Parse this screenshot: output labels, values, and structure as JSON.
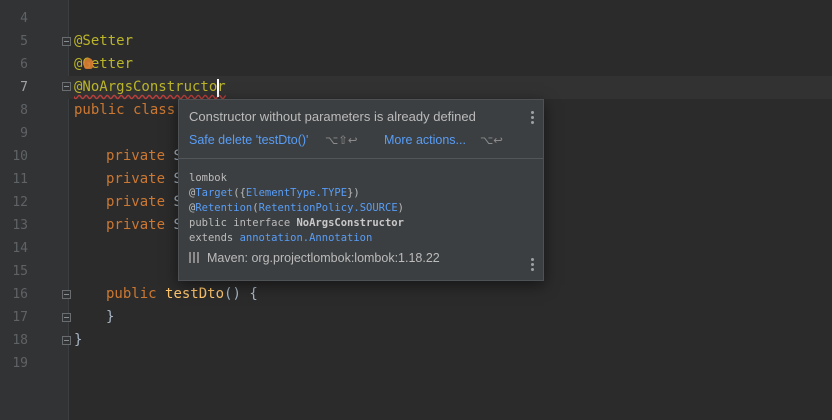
{
  "editor": {
    "line_numbers": [
      "5",
      "6",
      "7",
      "8",
      "9",
      "10",
      "11",
      "12",
      "13",
      "14",
      "15",
      "16",
      "17",
      "18",
      "19"
    ],
    "top_line_number": "4",
    "lines": {
      "l5": "@Setter",
      "l6_a": "@",
      "l6_b": "Getter",
      "l7": "@NoArgsConstructor",
      "l8_kw": "public class",
      "l10_kw": "private",
      "l10_rest": " S",
      "l11_kw": "private",
      "l11_rest": " S",
      "l12_kw": "private",
      "l12_rest": " S",
      "l13_kw": "private",
      "l13_rest": " S",
      "l16_kw": "public",
      "l16_fn": "testDto",
      "l16_rest": "() {",
      "l17": "}",
      "l18": "}"
    }
  },
  "popup": {
    "message": "Constructor without parameters is already defined",
    "action_primary": "Safe delete 'testDto()'",
    "action_primary_shortcut": "⌥⇧↩",
    "action_more": "More actions...",
    "action_more_shortcut": "⌥↩",
    "doc": {
      "package": "lombok",
      "target_at": "@",
      "target_name": "Target",
      "target_open": "({",
      "target_value": "ElementType.TYPE",
      "target_close": "})",
      "retention_at": "@",
      "retention_name": "Retention",
      "retention_open": "(",
      "retention_value": "RetentionPolicy.SOURCE",
      "retention_close": ")",
      "decl_prefix": "public interface ",
      "decl_name": "NoArgsConstructor",
      "extends_kw": "extends ",
      "extends_value": "annotation.Annotation"
    },
    "maven": "Maven: org.projectlombok:lombok:1.18.22"
  },
  "colors": {
    "background": "#2b2b2b",
    "gutter": "#313335",
    "annotation": "#bbb529",
    "keyword": "#cc7832",
    "function": "#ffc66d",
    "link": "#589df6",
    "popup_bg": "#3c3f41"
  }
}
